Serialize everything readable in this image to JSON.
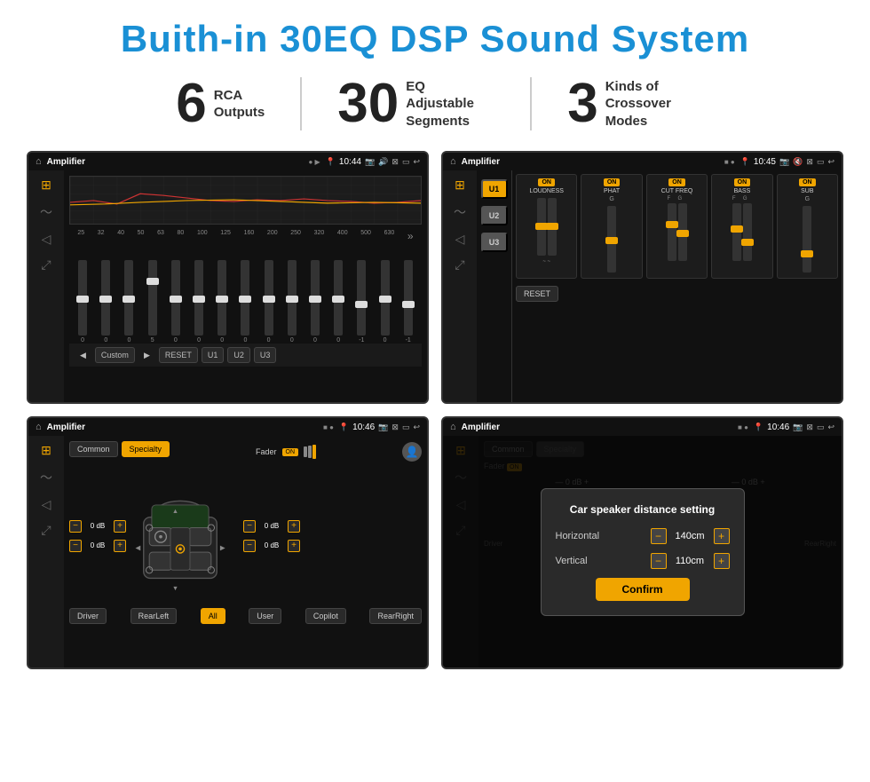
{
  "header": {
    "title": "Buith-in 30EQ DSP Sound System"
  },
  "stats": [
    {
      "number": "6",
      "label": "RCA\nOutputs"
    },
    {
      "number": "30",
      "label": "EQ Adjustable\nSegments"
    },
    {
      "number": "3",
      "label": "Kinds of\nCrossover Modes"
    }
  ],
  "screens": [
    {
      "id": "screen1",
      "app_name": "Amplifier",
      "time": "10:44",
      "type": "eq"
    },
    {
      "id": "screen2",
      "app_name": "Amplifier",
      "time": "10:45",
      "type": "amp"
    },
    {
      "id": "screen3",
      "app_name": "Amplifier",
      "time": "10:46",
      "type": "speaker"
    },
    {
      "id": "screen4",
      "app_name": "Amplifier",
      "time": "10:46",
      "type": "distance"
    }
  ],
  "eq": {
    "freqs": [
      "25",
      "32",
      "40",
      "50",
      "63",
      "80",
      "100",
      "125",
      "160",
      "200",
      "250",
      "320",
      "400",
      "500",
      "630"
    ],
    "values": [
      "0",
      "0",
      "0",
      "5",
      "0",
      "0",
      "0",
      "0",
      "0",
      "0",
      "0",
      "0",
      "-1",
      "0",
      "-1"
    ],
    "preset": "Custom",
    "buttons": [
      "RESET",
      "U1",
      "U2",
      "U3"
    ]
  },
  "amp_modules": [
    {
      "label": "LOUDNESS",
      "on": true
    },
    {
      "label": "PHAT",
      "on": true
    },
    {
      "label": "CUT FREQ",
      "on": true
    },
    {
      "label": "BASS",
      "on": true
    },
    {
      "label": "SUB",
      "on": true
    }
  ],
  "u_buttons": [
    "U1",
    "U2",
    "U3"
  ],
  "speaker": {
    "tabs": [
      "Common",
      "Specialty"
    ],
    "active_tab": "Specialty",
    "fader_label": "Fader",
    "fader_on": "ON",
    "volumes": [
      "0 dB",
      "0 dB",
      "0 dB",
      "0 dB"
    ],
    "buttons": [
      "Driver",
      "Copilot",
      "RearLeft",
      "All",
      "User",
      "RearRight"
    ]
  },
  "distance_dialog": {
    "title": "Car speaker distance setting",
    "horizontal_label": "Horizontal",
    "horizontal_value": "140cm",
    "vertical_label": "Vertical",
    "vertical_value": "110cm",
    "confirm_label": "Confirm"
  }
}
